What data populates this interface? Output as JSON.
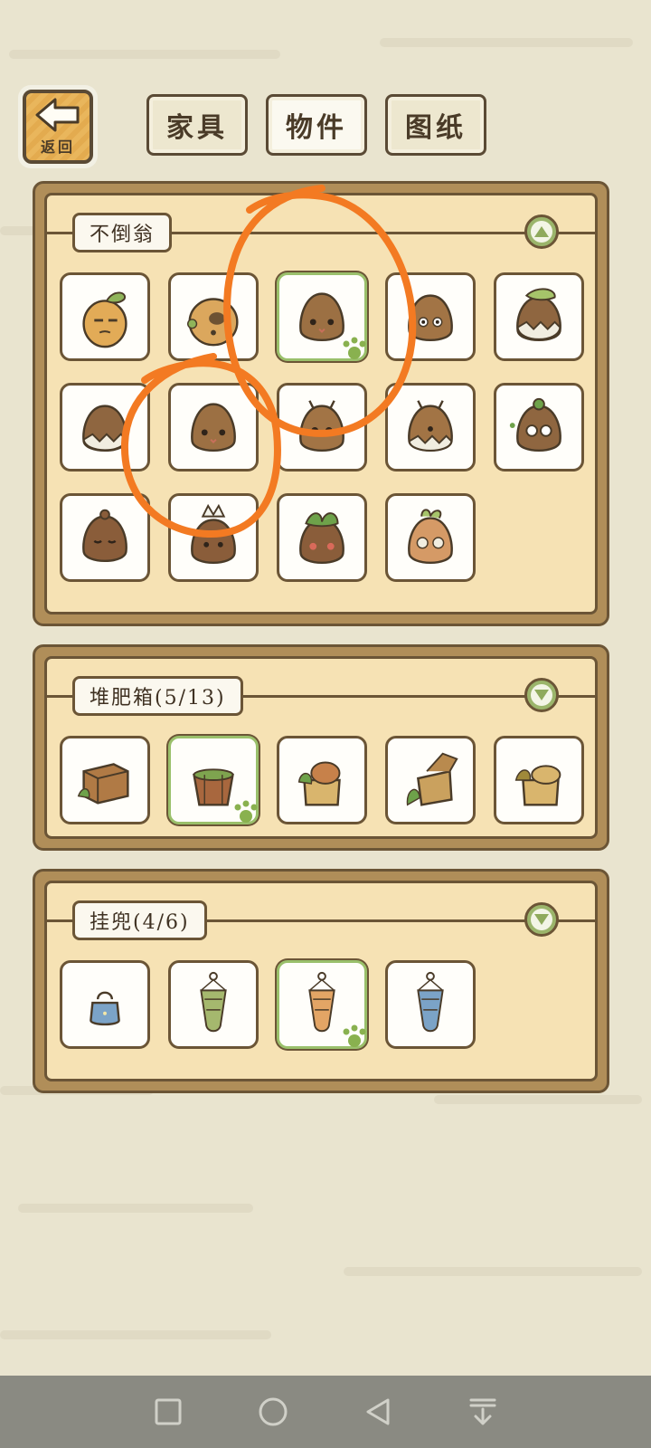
{
  "header": {
    "back_label": "返回",
    "tabs": [
      {
        "label": "家具",
        "active": false
      },
      {
        "label": "物件",
        "active": true
      },
      {
        "label": "图纸",
        "active": false
      }
    ]
  },
  "sections": [
    {
      "title": "不倒翁",
      "expanded": true,
      "item_count": 14,
      "selected_index": 2
    },
    {
      "title": "堆肥箱(5/13)",
      "expanded": false,
      "item_count": 5,
      "selected_index": 1
    },
    {
      "title": "挂兜(4/6)",
      "expanded": false,
      "item_count": 4,
      "selected_index": 2
    }
  ],
  "colors": {
    "background": "#e9e4cf",
    "panel_wood": "#b08e59",
    "panel_inner": "#f6e2b4",
    "selected_green": "#9ac06b",
    "annotation_orange": "#f37a22"
  }
}
